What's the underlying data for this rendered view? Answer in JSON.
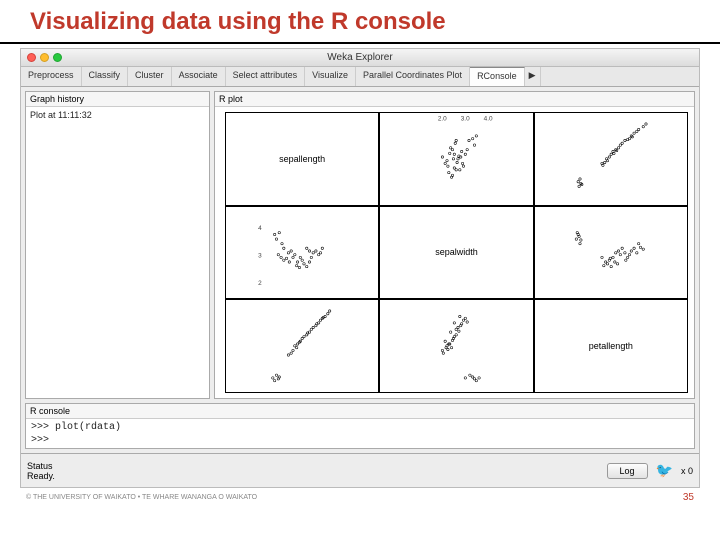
{
  "slide": {
    "title": "Visualizing data using the R console",
    "footer_left": "© THE UNIVERSITY OF WAIKATO  •  TE WHARE WANANGA O WAIKATO",
    "page_number": "35"
  },
  "window": {
    "title": "Weka Explorer"
  },
  "tabs": {
    "items": [
      {
        "label": "Preprocess"
      },
      {
        "label": "Classify"
      },
      {
        "label": "Cluster"
      },
      {
        "label": "Associate"
      },
      {
        "label": "Select attributes"
      },
      {
        "label": "Visualize"
      },
      {
        "label": "Parallel Coordinates Plot"
      },
      {
        "label": "RConsole"
      }
    ],
    "arrow": "▶"
  },
  "history_panel": {
    "label": "Graph history",
    "item": "Plot at 11:11:32"
  },
  "plot_panel": {
    "label": "R plot",
    "diag_labels": [
      "sepallength",
      "sepalwidth",
      "petallength"
    ]
  },
  "console": {
    "label": "R console",
    "line1": ">>> plot(rdata)",
    "line2": ">>>"
  },
  "status": {
    "label": "Status",
    "text": "Ready.",
    "log_button": "Log",
    "error_count": "x 0"
  },
  "chart_data": {
    "type": "scatter",
    "title": "pairs(iris) scatterplot matrix",
    "variables": [
      "sepallength",
      "sepalwidth",
      "petallength"
    ],
    "note": "3×3 matrix: diagonals show variable names, off-diagonals show pairwise scatter of iris dataset points (~150 points each). Axis ticks approx: sepallength [4.5–8], sepalwidth [2–4.5], petallength [1–7]."
  }
}
